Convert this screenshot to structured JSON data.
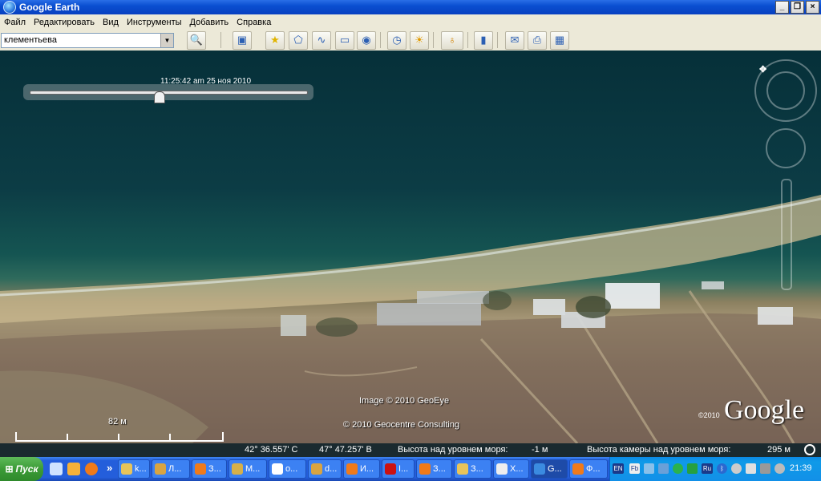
{
  "window": {
    "title": "Google Earth",
    "controls": [
      "_",
      "❐",
      "×"
    ]
  },
  "menu": [
    "Файл",
    "Редактировать",
    "Вид",
    "Инструменты",
    "Добавить",
    "Справка"
  ],
  "search": {
    "value": "клементьева"
  },
  "map": {
    "timestamp": "11:25:42 am 25 ноя 2010",
    "scale_label": "82 м",
    "imagery_credit": "Image © 2010 GeoEye",
    "copyright": "© 2010 Geocentre Consulting",
    "logo_year": "©2010",
    "logo_text": "Google"
  },
  "status": {
    "lat": "42° 36.557' С",
    "lon": "47° 47.257' В",
    "elev_label": "Высота над уровнем моря:",
    "elev_value": "-1 м",
    "eye_label": "Высота камеры над уровнем моря:",
    "eye_value": "295 м"
  },
  "taskbar": {
    "start_label": "Пуск",
    "overflow": "»",
    "tasks": [
      {
        "label": "k...",
        "color": "#e8c45a"
      },
      {
        "label": "Л...",
        "color": "#d9a441"
      },
      {
        "label": "З...",
        "color": "#f07a1a"
      },
      {
        "label": "М...",
        "color": "#d6b04a"
      },
      {
        "label": "о...",
        "color": "#ffffff"
      },
      {
        "label": "d...",
        "color": "#d9a441"
      },
      {
        "label": "И...",
        "color": "#f07a1a"
      },
      {
        "label": "I...",
        "color": "#cc1111"
      },
      {
        "label": "З...",
        "color": "#f07a1a"
      },
      {
        "label": "З...",
        "color": "#e8c45a"
      },
      {
        "label": "Х...",
        "color": "#eeeeee"
      },
      {
        "label": "G...",
        "color": "#3b8be0"
      },
      {
        "label": "Ф...",
        "color": "#f07a1a"
      }
    ],
    "lang": "EN",
    "lang2": "Ru",
    "clock": "21:39"
  }
}
